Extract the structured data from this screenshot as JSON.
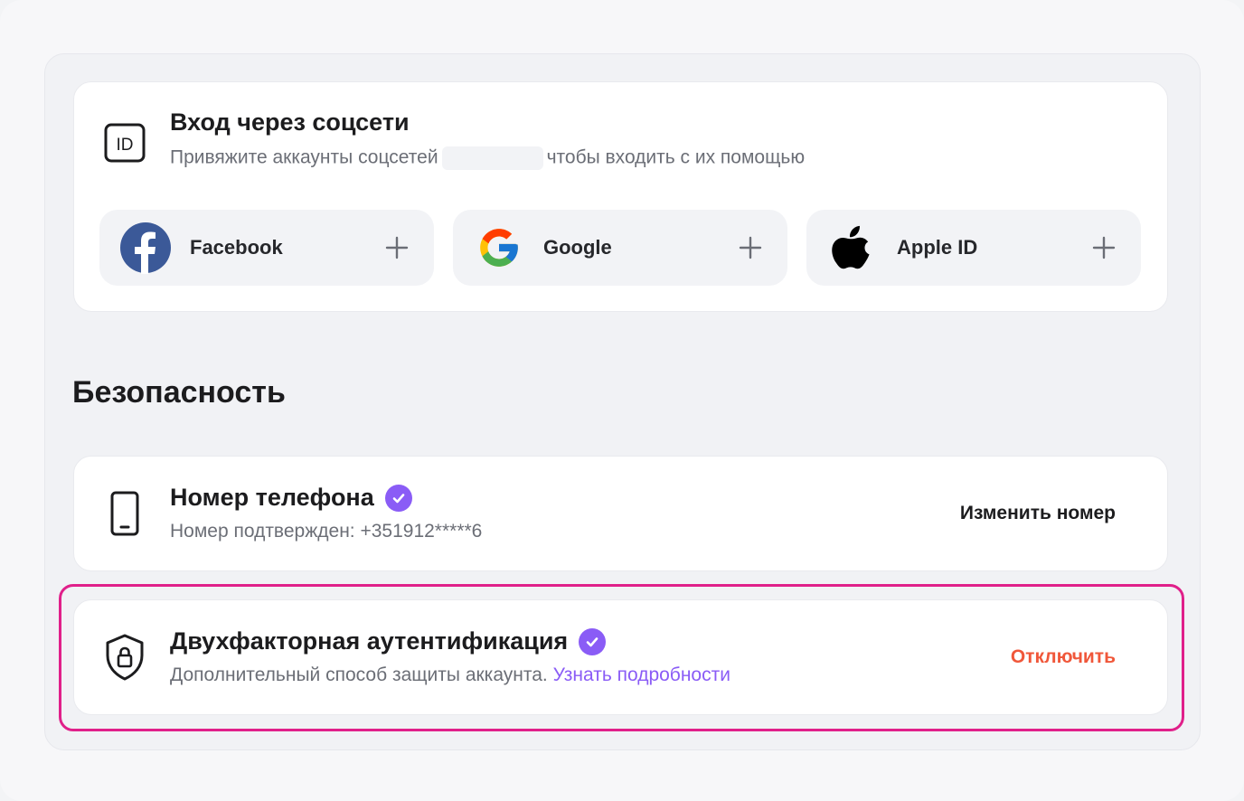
{
  "social": {
    "title": "Вход через соцсети",
    "subtitle_before": "Привяжите аккаунты соцсетей",
    "subtitle_after": "чтобы входить с их помощью",
    "id_icon_text": "ID",
    "providers": [
      {
        "label": "Facebook",
        "icon": "facebook-logo"
      },
      {
        "label": "Google",
        "icon": "google-logo"
      },
      {
        "label": "Apple ID",
        "icon": "apple-logo"
      }
    ]
  },
  "security": {
    "title": "Безопасность",
    "phone": {
      "title": "Номер телефона",
      "subtitle": "Номер подтвержден: +351912*****6",
      "action": "Изменить номер",
      "verified": true
    },
    "two_factor": {
      "title": "Двухфакторная аутентификация",
      "subtitle": "Дополнительный способ защиты аккаунта.",
      "link": "Узнать подробности",
      "action": "Отключить",
      "verified": true
    }
  },
  "colors": {
    "accent": "#8a5cf6",
    "danger": "#f0573a",
    "highlight": "#e0208a",
    "facebook": "#3b5998"
  }
}
